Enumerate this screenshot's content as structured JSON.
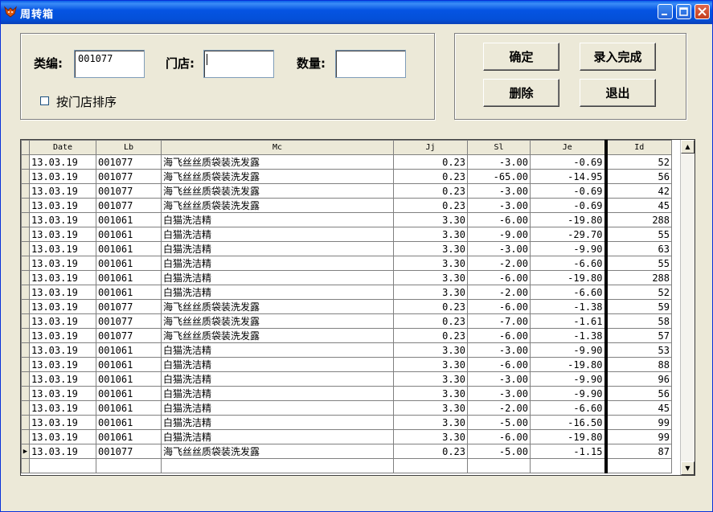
{
  "window": {
    "title": "周转箱"
  },
  "form": {
    "category_label": "类编:",
    "category_value": "001077",
    "store_label": "门店:",
    "store_value": "",
    "qty_label": "数量:",
    "qty_value": "",
    "sort_checkbox_label": "按门店排序",
    "sort_checked": false
  },
  "buttons": {
    "confirm": "确定",
    "finish": "录入完成",
    "delete": "删除",
    "exit": "退出"
  },
  "table": {
    "columns": [
      "Date",
      "Lb",
      "Mc",
      "Jj",
      "Sl",
      "Je",
      "Id"
    ],
    "rows": [
      [
        "13.03.19",
        "001077",
        "海飞丝丝质袋装洗发露",
        "0.23",
        "-3.00",
        "-0.69",
        "52"
      ],
      [
        "13.03.19",
        "001077",
        "海飞丝丝质袋装洗发露",
        "0.23",
        "-65.00",
        "-14.95",
        "56"
      ],
      [
        "13.03.19",
        "001077",
        "海飞丝丝质袋装洗发露",
        "0.23",
        "-3.00",
        "-0.69",
        "42"
      ],
      [
        "13.03.19",
        "001077",
        "海飞丝丝质袋装洗发露",
        "0.23",
        "-3.00",
        "-0.69",
        "45"
      ],
      [
        "13.03.19",
        "001061",
        "白猫洗洁精",
        "3.30",
        "-6.00",
        "-19.80",
        "288"
      ],
      [
        "13.03.19",
        "001061",
        "白猫洗洁精",
        "3.30",
        "-9.00",
        "-29.70",
        "55"
      ],
      [
        "13.03.19",
        "001061",
        "白猫洗洁精",
        "3.30",
        "-3.00",
        "-9.90",
        "63"
      ],
      [
        "13.03.19",
        "001061",
        "白猫洗洁精",
        "3.30",
        "-2.00",
        "-6.60",
        "55"
      ],
      [
        "13.03.19",
        "001061",
        "白猫洗洁精",
        "3.30",
        "-6.00",
        "-19.80",
        "288"
      ],
      [
        "13.03.19",
        "001061",
        "白猫洗洁精",
        "3.30",
        "-2.00",
        "-6.60",
        "52"
      ],
      [
        "13.03.19",
        "001077",
        "海飞丝丝质袋装洗发露",
        "0.23",
        "-6.00",
        "-1.38",
        "59"
      ],
      [
        "13.03.19",
        "001077",
        "海飞丝丝质袋装洗发露",
        "0.23",
        "-7.00",
        "-1.61",
        "58"
      ],
      [
        "13.03.19",
        "001077",
        "海飞丝丝质袋装洗发露",
        "0.23",
        "-6.00",
        "-1.38",
        "57"
      ],
      [
        "13.03.19",
        "001061",
        "白猫洗洁精",
        "3.30",
        "-3.00",
        "-9.90",
        "53"
      ],
      [
        "13.03.19",
        "001061",
        "白猫洗洁精",
        "3.30",
        "-6.00",
        "-19.80",
        "88"
      ],
      [
        "13.03.19",
        "001061",
        "白猫洗洁精",
        "3.30",
        "-3.00",
        "-9.90",
        "96"
      ],
      [
        "13.03.19",
        "001061",
        "白猫洗洁精",
        "3.30",
        "-3.00",
        "-9.90",
        "56"
      ],
      [
        "13.03.19",
        "001061",
        "白猫洗洁精",
        "3.30",
        "-2.00",
        "-6.60",
        "45"
      ],
      [
        "13.03.19",
        "001061",
        "白猫洗洁精",
        "3.30",
        "-5.00",
        "-16.50",
        "99"
      ],
      [
        "13.03.19",
        "001061",
        "白猫洗洁精",
        "3.30",
        "-6.00",
        "-19.80",
        "99"
      ],
      [
        "13.03.19",
        "001077",
        "海飞丝丝质袋装洗发露",
        "0.23",
        "-5.00",
        "-1.15",
        "87"
      ]
    ],
    "current_row_index": 20
  }
}
